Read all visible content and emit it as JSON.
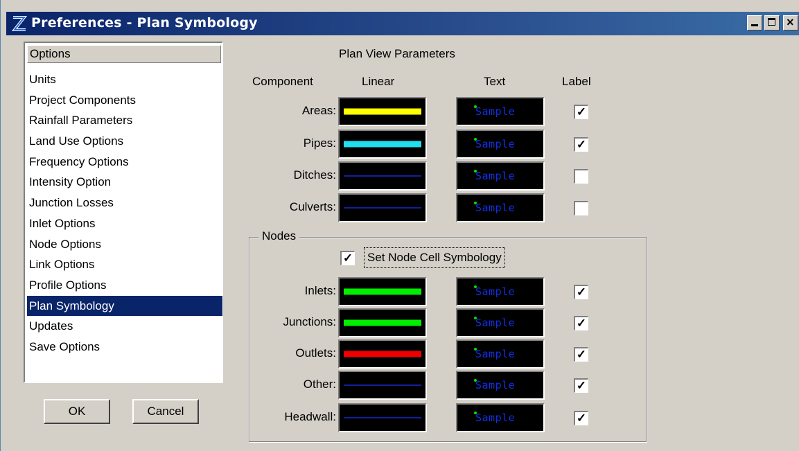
{
  "window": {
    "title": "Preferences - Plan Symbology"
  },
  "options": {
    "header": "Options",
    "items": [
      "Units",
      "Project Components",
      "Rainfall Parameters",
      "Land Use Options",
      "Frequency Options",
      "Intensity Option",
      "Junction Losses",
      "Inlet Options",
      "Node Options",
      "Link Options",
      "Profile Options",
      "Plan Symbology",
      "Updates",
      "Save Options"
    ],
    "selected": "Plan Symbology"
  },
  "buttons": {
    "ok": "OK",
    "cancel": "Cancel"
  },
  "plan": {
    "title": "Plan View Parameters",
    "columns": {
      "component": "Component",
      "linear": "Linear",
      "text": "Text",
      "label": "Label"
    },
    "sample_text": "Sample",
    "components": [
      {
        "label": "Areas:",
        "color": "#ffff00",
        "thick": true,
        "checked": true
      },
      {
        "label": "Pipes:",
        "color": "#20e0f0",
        "thick": true,
        "checked": true
      },
      {
        "label": "Ditches:",
        "color": "#1020a0",
        "thick": false,
        "checked": false
      },
      {
        "label": "Culverts:",
        "color": "#1020a0",
        "thick": false,
        "checked": false
      }
    ]
  },
  "nodes": {
    "title": "Nodes",
    "set_node_label": "Set Node Cell Symbology",
    "set_node_checked": true,
    "items": [
      {
        "label": "Inlets:",
        "color": "#00ee00",
        "thick": true,
        "checked": true
      },
      {
        "label": "Junctions:",
        "color": "#00ee00",
        "thick": true,
        "checked": true
      },
      {
        "label": "Outlets:",
        "color": "#ee0000",
        "thick": true,
        "checked": true
      },
      {
        "label": "Other:",
        "color": "#1020a0",
        "thick": false,
        "checked": true
      },
      {
        "label": "Headwall:",
        "color": "#1020a0",
        "thick": false,
        "checked": true
      }
    ]
  }
}
